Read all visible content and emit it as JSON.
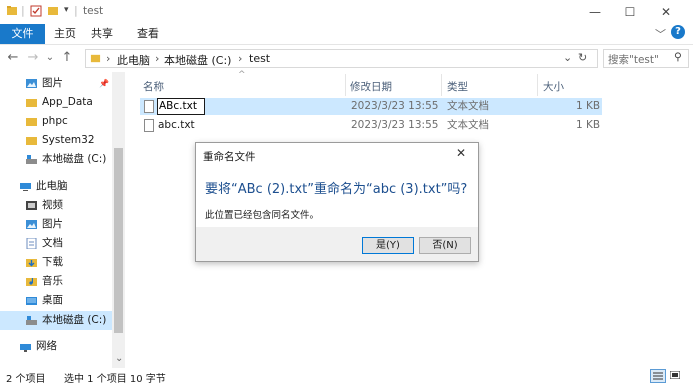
{
  "titlebar": {
    "title": "test",
    "qat_sep": "|",
    "chevron": "▾",
    "minimize": "—",
    "maximize": "☐",
    "close": "✕"
  },
  "ribbon": {
    "tabs": [
      "文件",
      "主页",
      "共享",
      "查看"
    ],
    "expand": "﹀",
    "help": "?"
  },
  "address": {
    "back": "←",
    "forward": "→",
    "recent": "⌄",
    "up": "↑",
    "path": [
      "此电脑",
      "本地磁盘 (C:)",
      "test"
    ],
    "sep": "›",
    "dropdown": "⌄",
    "refresh": "↻",
    "search_placeholder": "搜索\"test\"",
    "search_icon": "⚲"
  },
  "nav": {
    "items": [
      {
        "label": "图片",
        "icon": "pictures-icon",
        "pin": "📌"
      },
      {
        "label": "App_Data",
        "icon": "folder-icon"
      },
      {
        "label": "phpc",
        "icon": "folder-icon"
      },
      {
        "label": "System32",
        "icon": "folder-icon"
      },
      {
        "label": "本地磁盘 (C:)",
        "icon": "drive-icon"
      },
      {
        "label": "此电脑",
        "icon": "computer-icon"
      },
      {
        "label": "视频",
        "icon": "videos-icon"
      },
      {
        "label": "图片",
        "icon": "pictures-icon"
      },
      {
        "label": "文档",
        "icon": "documents-icon"
      },
      {
        "label": "下载",
        "icon": "downloads-icon"
      },
      {
        "label": "音乐",
        "icon": "music-icon"
      },
      {
        "label": "桌面",
        "icon": "desktop-icon"
      },
      {
        "label": "本地磁盘 (C:)",
        "icon": "drive-icon"
      },
      {
        "label": "网络",
        "icon": "network-icon"
      }
    ],
    "scroll_up": "^",
    "scroll_down": "⌄"
  },
  "columns": {
    "sort_arrow": "^",
    "name": "名称",
    "modified": "修改日期",
    "type": "类型",
    "size": "大小"
  },
  "files": [
    {
      "name": "ABc.txt",
      "modified": "2023/3/23 13:55",
      "type": "文本文档",
      "size": "1 KB"
    },
    {
      "name": "abc.txt",
      "modified": "2023/3/23 13:55",
      "type": "文本文档",
      "size": "1 KB"
    }
  ],
  "dialog": {
    "title": "重命名文件",
    "close": "✕",
    "question": "要将“ABc (2).txt”重命名为“abc (3).txt”吗?",
    "info": "此位置已经包含同名文件。",
    "yes": "是(Y)",
    "no": "否(N)"
  },
  "status": {
    "count": "2 个项目",
    "selection": "选中 1 个项目  10 字节"
  },
  "colors": {
    "accent": "#1979ca",
    "selection": "#cce8ff",
    "dialog_text": "#1d4f8f"
  }
}
